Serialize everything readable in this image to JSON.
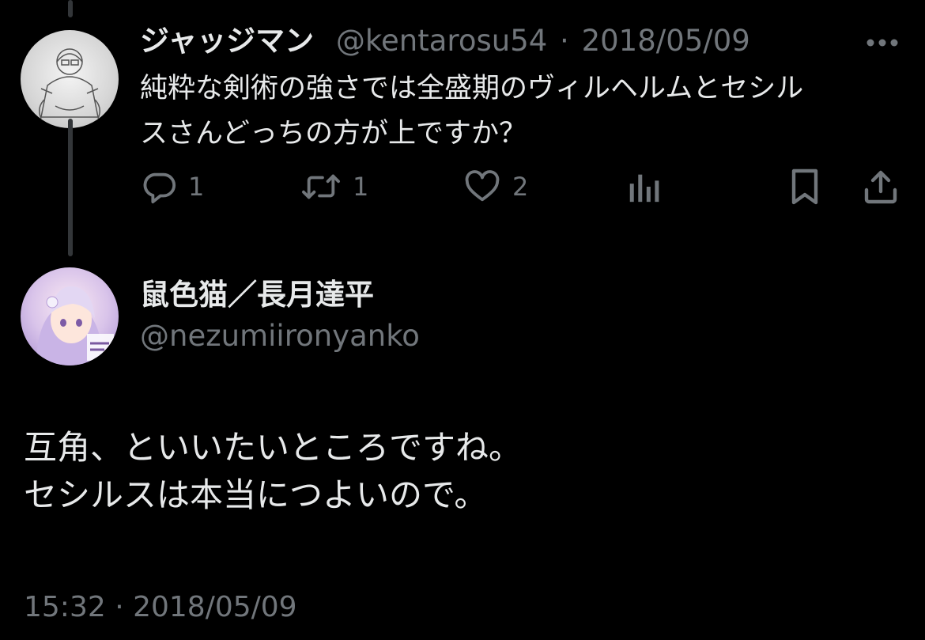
{
  "reply": {
    "author_name": "ジャッジマン",
    "handle": "@kentarosu54",
    "separator": "·",
    "date": "2018/05/09",
    "text_line1": "純粋な剣術の強さでは全盛期のヴィルヘルムとセシル",
    "text_line2": "スさんどっちの方が上ですか？",
    "actions": {
      "reply_count": "1",
      "retweet_count": "1",
      "like_count": "2"
    }
  },
  "main_tweet": {
    "author_name": "鼠色猫／長月達平",
    "handle": "@nezumiironyanko",
    "text_line1": "互角、といいたいところですね。",
    "text_line2": "セシルスは本当につよいので。",
    "timestamp": "15:32 · 2018/05/09"
  },
  "colors": {
    "background": "#000000",
    "text": "#e7e9ea",
    "secondary": "#71767b",
    "thread_line": "#333639"
  }
}
